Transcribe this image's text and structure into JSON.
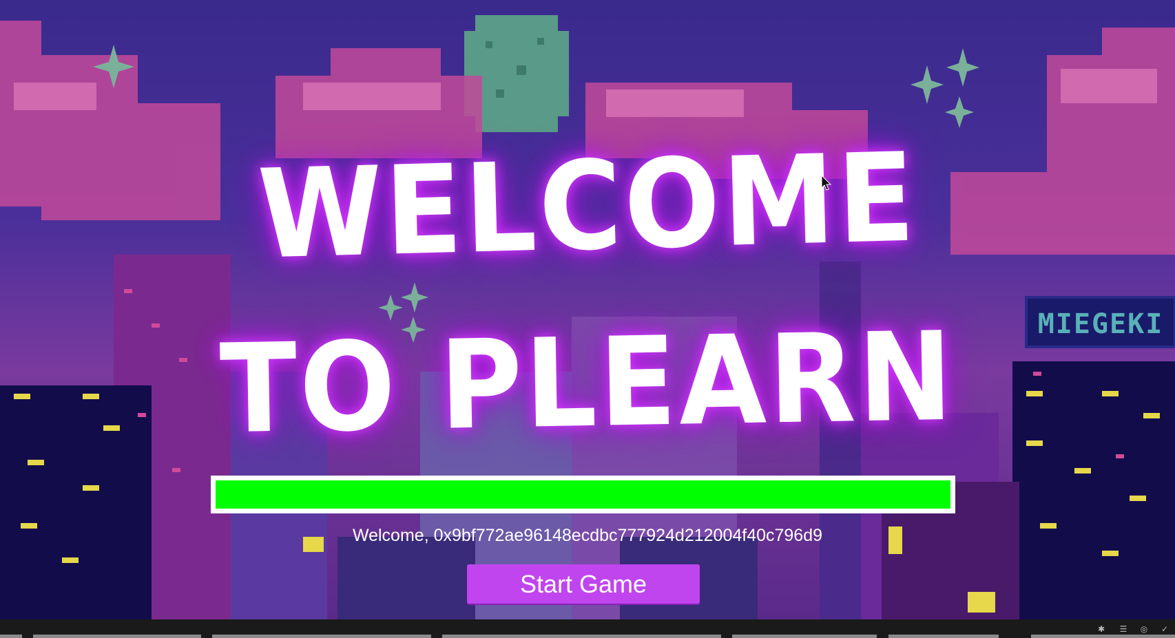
{
  "title": {
    "line1": "WELCOME",
    "line2": "TO PLEARN"
  },
  "loading": {
    "progress_percent": 100,
    "fill_color": "#00ff00"
  },
  "welcome": {
    "prefix": "Welcome, ",
    "address": "0x9bf772ae96148ecdbc777924d212004f40c796d9"
  },
  "start_button": {
    "label": "Start Game",
    "color": "#c045ee"
  },
  "billboard": {
    "text": "MIEGEKI"
  },
  "icons": [
    "star-icon",
    "moon-icon",
    "cursor-icon",
    "tray-icon"
  ],
  "colors": {
    "sky": "#3a2a8a",
    "clouds": "#c84a9e",
    "glow": "#d23cff"
  }
}
